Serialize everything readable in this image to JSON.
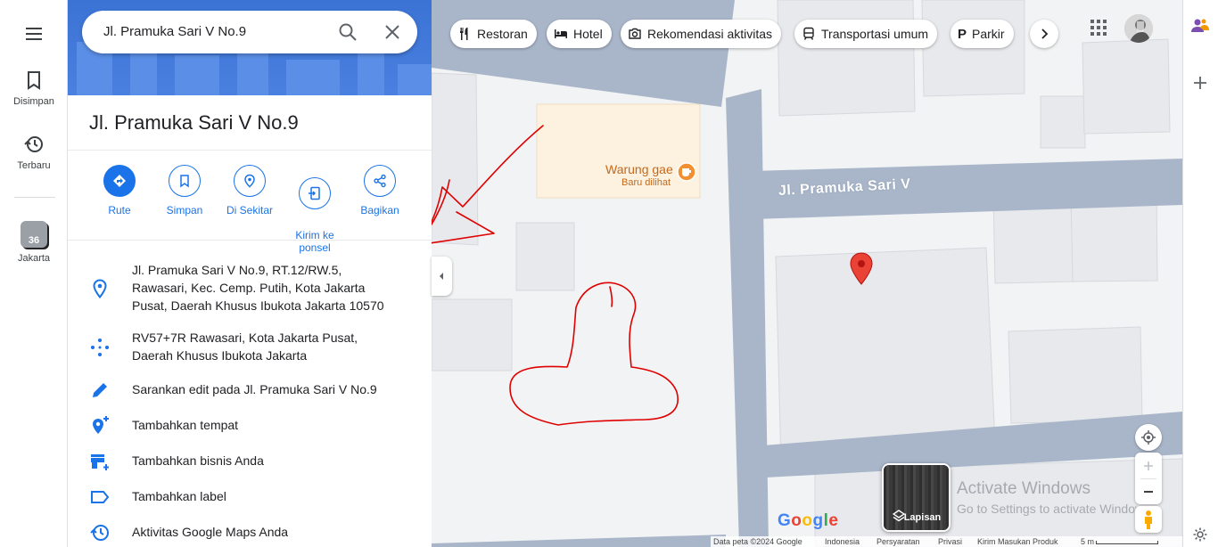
{
  "rail": {
    "saved_label": "Disimpan",
    "recent_label": "Terbaru",
    "recent_place_label": "Jakarta",
    "recent_place_badge": "36"
  },
  "search": {
    "value": "Jl. Pramuka Sari V No.9"
  },
  "place": {
    "title": "Jl. Pramuka Sari V No.9",
    "actions": [
      {
        "label": "Rute"
      },
      {
        "label": "Simpan"
      },
      {
        "label": "Di Sekitar"
      },
      {
        "label": "Kirim ke\nponsel"
      },
      {
        "label": "Bagikan"
      }
    ],
    "address": "Jl. Pramuka Sari V No.9, RT.12/RW.5, Rawasari, Kec. Cemp. Putih, Kota Jakarta Pusat, Daerah Khusus Ibukota Jakarta 10570",
    "plus_code": "RV57+7R Rawasari, Kota Jakarta Pusat, Daerah Khusus Ibukota Jakarta",
    "suggest_edit": "Sarankan edit pada Jl. Pramuka Sari V No.9",
    "add_place": "Tambahkan tempat",
    "add_business": "Tambahkan bisnis Anda",
    "add_label": "Tambahkan label",
    "activity": "Aktivitas Google Maps Anda"
  },
  "chips": [
    "Restoran",
    "Hotel",
    "Rekomendasi aktivitas",
    "Transportasi umum",
    "Parkir"
  ],
  "map": {
    "street_label": "Jl. Pramuka Sari V",
    "poi_name": "Warung gae",
    "poi_sub": "Baru dilihat",
    "layers_label": "Lapisan",
    "google_logo": "Google",
    "watermark_title": "Activate Windows",
    "watermark_sub": "Go to Settings to activate Windows.",
    "footer": [
      "Data peta ©2024 Google",
      "Indonesia",
      "Persyaratan",
      "Privasi",
      "Kirim Masukan Produk",
      "5 m"
    ],
    "colors": {
      "road": "#a9b6c9",
      "building": "#e8e9ed",
      "poi_fill": "#fdf2e0",
      "poi_text": "#c5681a",
      "pin": "#ea4335",
      "annotation": "#e00000"
    }
  },
  "right_sidebar": {
    "icons": [
      "people-icon",
      "plus-icon",
      "gear-icon"
    ]
  }
}
